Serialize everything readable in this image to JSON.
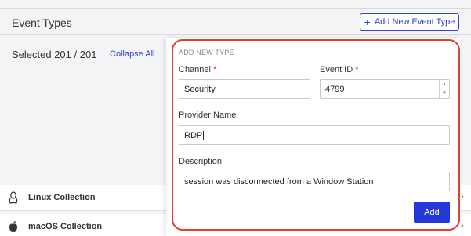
{
  "section": {
    "title": "Event Types",
    "add_button_label": "Add New Event Type",
    "selected_text": "Selected 201 / 201",
    "collapse_label": "Collapse All"
  },
  "collections": [
    {
      "label": "Linux Collection",
      "icon": "linux-penguin-icon"
    },
    {
      "label": "macOS Collection",
      "icon": "apple-icon"
    }
  ],
  "form": {
    "header": "ADD NEW TYPE",
    "channel_label": "Channel",
    "channel_value": "Security",
    "event_id_label": "Event ID",
    "event_id_value": "4799",
    "provider_label": "Provider Name",
    "provider_value": "RDP",
    "description_label": "Description",
    "description_value": "session was disconnected from a Window Station",
    "required_mark": "*",
    "add_label": "Add"
  },
  "colors": {
    "accent": "#2438d8",
    "highlight": "#e0412f",
    "required": "#e03030"
  }
}
